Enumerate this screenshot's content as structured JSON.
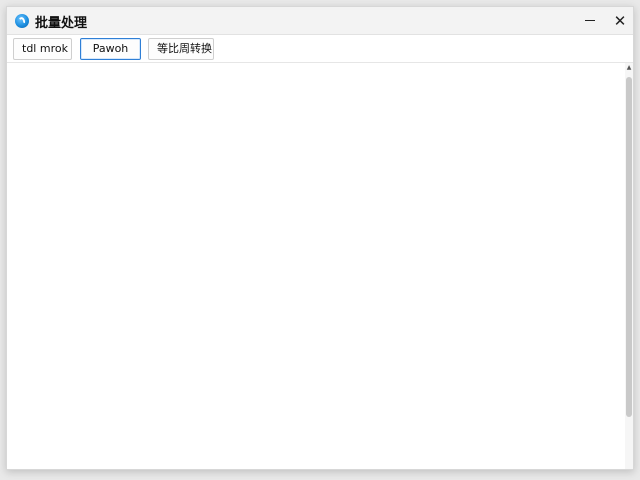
{
  "window": {
    "title": "批量处理",
    "minimize_glyph": "—",
    "close_glyph": "✕",
    "icons": {
      "app": "app-logo-icon",
      "minimize": "minimize-icon",
      "close": "close-icon",
      "scroll_up": "scroll-up-arrow-icon"
    }
  },
  "toolbar": {
    "buttons": [
      {
        "label": "tdl mrok"
      },
      {
        "label": "Pawoh"
      },
      {
        "label": "等比周转换"
      }
    ]
  },
  "scrollbar": {
    "up_glyph": "▲"
  },
  "colors": {
    "accent": "#2f7fd6",
    "titlebar_bg": "#f3f3f3",
    "window_bg": "#ffffff"
  }
}
